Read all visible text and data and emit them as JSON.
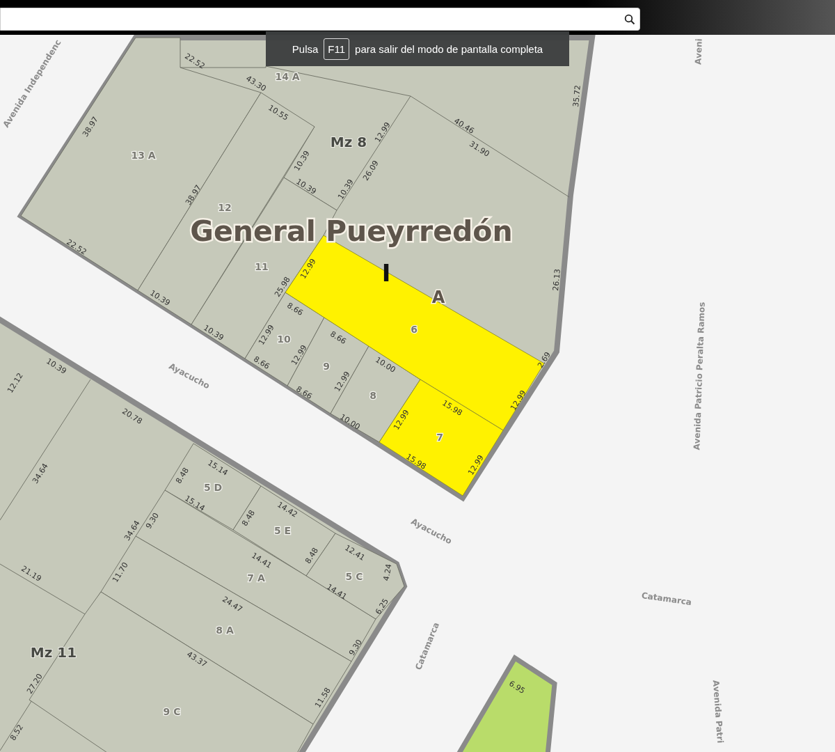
{
  "search_bar": {
    "kind": "search"
  },
  "fullscreen_notice": {
    "prefix": "Pulsa",
    "key": "F11",
    "suffix": "para salir del modo de pantalla completa"
  },
  "map": {
    "locality_label": "General Pueyrredón",
    "section_label": "I",
    "subsection_label": "A",
    "blocks": [
      {
        "label": "Mz 8"
      },
      {
        "label": "Mz 11"
      }
    ],
    "streets": [
      "Avenida Independenc",
      "Aveni",
      "Ayacucho",
      "Ayacucho",
      "Catamarca",
      "Catamarca",
      "Avenida Patricio Peralta Ramos",
      "Avenida Patri"
    ],
    "parcels": [
      {
        "label": "14 A",
        "selected": false
      },
      {
        "label": "13 A",
        "selected": false
      },
      {
        "label": "12",
        "selected": false
      },
      {
        "label": "11",
        "selected": false
      },
      {
        "label": "10",
        "selected": false
      },
      {
        "label": "9",
        "selected": false
      },
      {
        "label": "8",
        "selected": false
      },
      {
        "label": "6",
        "selected": true
      },
      {
        "label": "7",
        "selected": true
      },
      {
        "label": "5 D",
        "selected": false
      },
      {
        "label": "5 E",
        "selected": false
      },
      {
        "label": "7 A",
        "selected": false
      },
      {
        "label": "5 C",
        "selected": false
      },
      {
        "label": "8 A",
        "selected": false
      },
      {
        "label": "9 C",
        "selected": false
      }
    ],
    "measurements": [
      "22.52",
      "43.30",
      "10.55",
      "38.97",
      "38.97",
      "10.39",
      "10.39",
      "12.99",
      "26.09",
      "10.39",
      "40.46",
      "31.90",
      "35.72",
      "26.13",
      "22.52",
      "10.39",
      "10.39",
      "12.99",
      "25.98",
      "8.66",
      "12.99",
      "8.66",
      "8.66",
      "12.99",
      "8.66",
      "12.99",
      "10.00",
      "10.00",
      "2.69",
      "12.99",
      "15.98",
      "12.99",
      "15.98",
      "12.99",
      "12.12",
      "10.39",
      "20.78",
      "34.64",
      "8.48",
      "15.14",
      "15.14",
      "9.30",
      "34.64",
      "14.42",
      "8.48",
      "8.48",
      "12.41",
      "14.41",
      "4.24",
      "14.41",
      "6.25",
      "21.19",
      "11.70",
      "24.47",
      "9.30",
      "43.37",
      "11.58",
      "27.20",
      "8.52",
      "6.95"
    ]
  }
}
